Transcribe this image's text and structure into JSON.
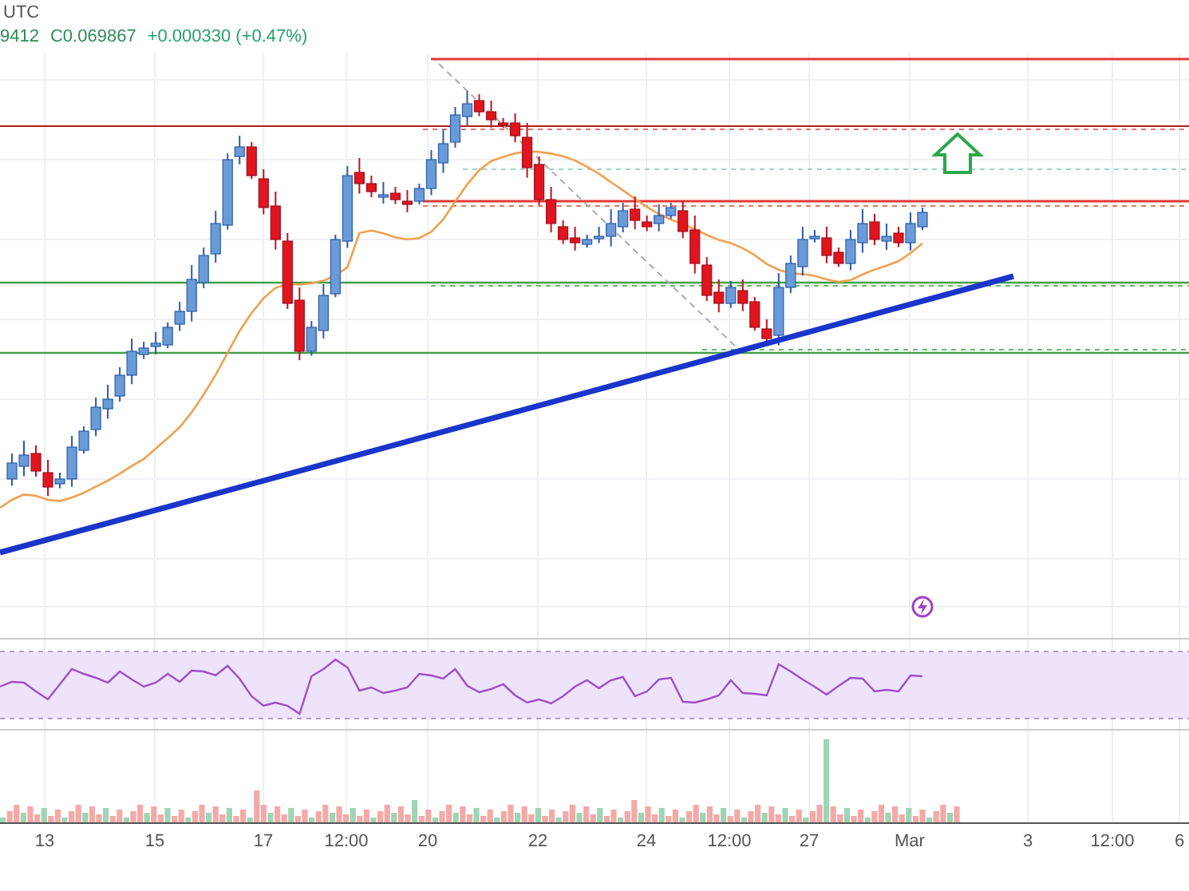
{
  "header": {
    "timezone": "UTC",
    "values": [
      {
        "text": "9412",
        "kind": "plain"
      },
      {
        "text": "C0.069867",
        "kind": "plain"
      },
      {
        "text": "+0.000330 (+0.47%)",
        "kind": "change"
      }
    ]
  },
  "x_axis": {
    "labels": [
      "13",
      "15",
      "17",
      "12:00",
      "20",
      "22",
      "24",
      "12:00",
      "27",
      "Mar",
      "3",
      "12:00",
      "6"
    ]
  }
}
